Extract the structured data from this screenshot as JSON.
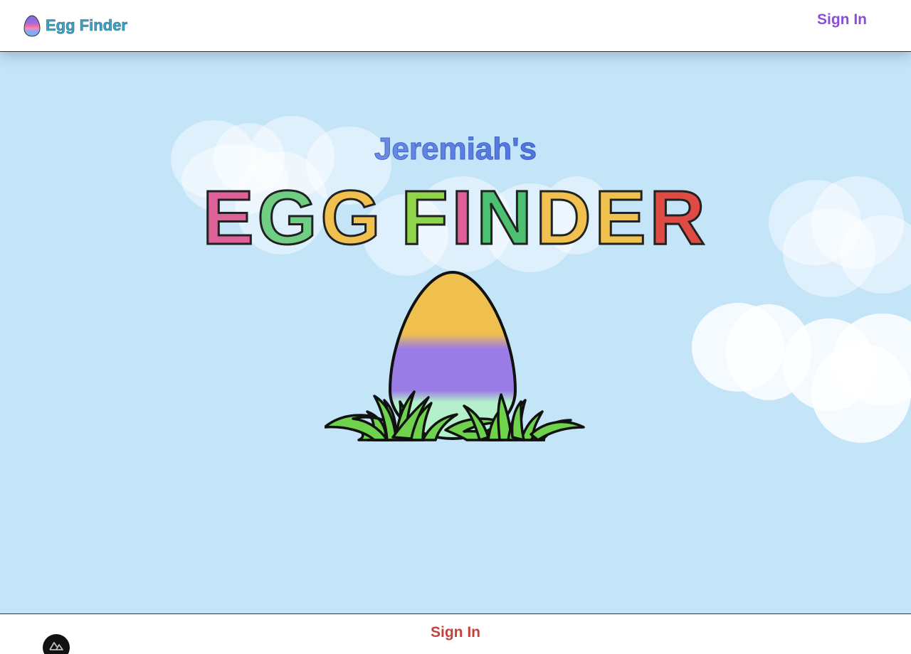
{
  "header": {
    "brand": "Egg Finder",
    "sign_in": "Sign In"
  },
  "hero": {
    "subtitle": "Jeremiah's",
    "title_letters": [
      {
        "char": "E",
        "color": "#e0609a"
      },
      {
        "char": "G",
        "color": "#6fce84"
      },
      {
        "char": "G",
        "color": "#f0c14e"
      },
      {
        "char": " ",
        "color": "transparent"
      },
      {
        "char": "F",
        "color": "#8fd44a"
      },
      {
        "char": "I",
        "color": "#e0609a"
      },
      {
        "char": "N",
        "color": "#4cc070"
      },
      {
        "char": "D",
        "color": "#f0c14e"
      },
      {
        "char": "E",
        "color": "#f0c14e"
      },
      {
        "char": "R",
        "color": "#e04a44"
      }
    ]
  },
  "footer": {
    "sign_in": "Sign In"
  },
  "icons": {
    "brand": "egg-icon",
    "fab": "nuxt-logo-icon",
    "scene": "egg-in-grass-icon"
  },
  "colors": {
    "sky": "#c4e4f8",
    "brand_text": "#3fa2c6",
    "sign_in_top": "#8c4ed8",
    "sign_in_bottom": "#c8403a",
    "egg_top": "#f0c04e",
    "egg_middle": "#9a7ce6",
    "egg_bottom": "#b4f0cc",
    "grass": "#6fd24c"
  }
}
